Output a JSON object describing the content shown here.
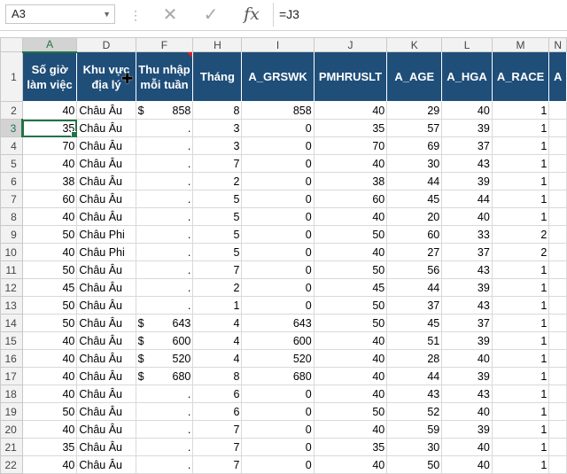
{
  "formula_bar": {
    "name_box": "A3",
    "cancel_icon": "✕",
    "enter_icon": "✓",
    "fx_label": "fx",
    "formula": "=J3"
  },
  "columns": [
    "A",
    "D",
    "F",
    "H",
    "I",
    "J",
    "K",
    "L",
    "M",
    "N"
  ],
  "headers": [
    "Số giờ làm việc",
    "Khu vực địa lý",
    "Thu nhập mỗi tuần",
    "Tháng",
    "A_GRSWK",
    "PMHRUSLT",
    "A_AGE",
    "A_HGA",
    "A_RACE",
    "A"
  ],
  "rows": [
    {
      "n": "2",
      "a": "40",
      "d": "Châu Âu",
      "f_sym": "$",
      "f": "858",
      "h": "8",
      "i": "858",
      "j": "40",
      "k": "29",
      "l": "40",
      "m": "1"
    },
    {
      "n": "3",
      "a": "35",
      "d": "Châu Âu",
      "f_sym": "",
      "f": ".",
      "h": "3",
      "i": "0",
      "j": "35",
      "k": "57",
      "l": "39",
      "m": "1"
    },
    {
      "n": "4",
      "a": "70",
      "d": "Châu Âu",
      "f_sym": "",
      "f": ".",
      "h": "3",
      "i": "0",
      "j": "70",
      "k": "69",
      "l": "37",
      "m": "1"
    },
    {
      "n": "5",
      "a": "40",
      "d": "Châu Âu",
      "f_sym": "",
      "f": ".",
      "h": "7",
      "i": "0",
      "j": "40",
      "k": "30",
      "l": "43",
      "m": "1"
    },
    {
      "n": "6",
      "a": "38",
      "d": "Châu Âu",
      "f_sym": "",
      "f": ".",
      "h": "2",
      "i": "0",
      "j": "38",
      "k": "44",
      "l": "39",
      "m": "1"
    },
    {
      "n": "7",
      "a": "60",
      "d": "Châu Âu",
      "f_sym": "",
      "f": ".",
      "h": "5",
      "i": "0",
      "j": "60",
      "k": "45",
      "l": "44",
      "m": "1"
    },
    {
      "n": "8",
      "a": "40",
      "d": "Châu Âu",
      "f_sym": "",
      "f": ".",
      "h": "5",
      "i": "0",
      "j": "40",
      "k": "20",
      "l": "40",
      "m": "1"
    },
    {
      "n": "9",
      "a": "50",
      "d": "Châu Phi",
      "f_sym": "",
      "f": ".",
      "h": "5",
      "i": "0",
      "j": "50",
      "k": "60",
      "l": "33",
      "m": "2"
    },
    {
      "n": "10",
      "a": "40",
      "d": "Châu Phi",
      "f_sym": "",
      "f": ".",
      "h": "5",
      "i": "0",
      "j": "40",
      "k": "27",
      "l": "37",
      "m": "2"
    },
    {
      "n": "11",
      "a": "50",
      "d": "Châu Âu",
      "f_sym": "",
      "f": ".",
      "h": "7",
      "i": "0",
      "j": "50",
      "k": "56",
      "l": "43",
      "m": "1"
    },
    {
      "n": "12",
      "a": "45",
      "d": "Châu Âu",
      "f_sym": "",
      "f": ".",
      "h": "2",
      "i": "0",
      "j": "45",
      "k": "44",
      "l": "39",
      "m": "1"
    },
    {
      "n": "13",
      "a": "50",
      "d": "Châu Âu",
      "f_sym": "",
      "f": ".",
      "h": "1",
      "i": "0",
      "j": "50",
      "k": "37",
      "l": "43",
      "m": "1"
    },
    {
      "n": "14",
      "a": "50",
      "d": "Châu Âu",
      "f_sym": "$",
      "f": "643",
      "h": "4",
      "i": "643",
      "j": "50",
      "k": "45",
      "l": "37",
      "m": "1"
    },
    {
      "n": "15",
      "a": "40",
      "d": "Châu Âu",
      "f_sym": "$",
      "f": "600",
      "h": "4",
      "i": "600",
      "j": "40",
      "k": "51",
      "l": "39",
      "m": "1"
    },
    {
      "n": "16",
      "a": "40",
      "d": "Châu Âu",
      "f_sym": "$",
      "f": "520",
      "h": "4",
      "i": "520",
      "j": "40",
      "k": "28",
      "l": "40",
      "m": "1"
    },
    {
      "n": "17",
      "a": "40",
      "d": "Châu Âu",
      "f_sym": "$",
      "f": "680",
      "h": "8",
      "i": "680",
      "j": "40",
      "k": "44",
      "l": "39",
      "m": "1"
    },
    {
      "n": "18",
      "a": "40",
      "d": "Châu Âu",
      "f_sym": "",
      "f": ".",
      "h": "6",
      "i": "0",
      "j": "40",
      "k": "43",
      "l": "43",
      "m": "1"
    },
    {
      "n": "19",
      "a": "50",
      "d": "Châu Âu",
      "f_sym": "",
      "f": ".",
      "h": "6",
      "i": "0",
      "j": "50",
      "k": "52",
      "l": "40",
      "m": "1"
    },
    {
      "n": "20",
      "a": "40",
      "d": "Châu Âu",
      "f_sym": "",
      "f": ".",
      "h": "7",
      "i": "0",
      "j": "40",
      "k": "59",
      "l": "39",
      "m": "1"
    },
    {
      "n": "21",
      "a": "35",
      "d": "Châu Âu",
      "f_sym": "",
      "f": ".",
      "h": "7",
      "i": "0",
      "j": "35",
      "k": "30",
      "l": "40",
      "m": "1"
    },
    {
      "n": "22",
      "a": "40",
      "d": "Châu Âu",
      "f_sym": "",
      "f": ".",
      "h": "7",
      "i": "0",
      "j": "40",
      "k": "50",
      "l": "40",
      "m": "1"
    }
  ],
  "colors": {
    "header_fill": "#1f4e79",
    "selection": "#217346"
  },
  "header_row_number": "1",
  "active_row": "3"
}
